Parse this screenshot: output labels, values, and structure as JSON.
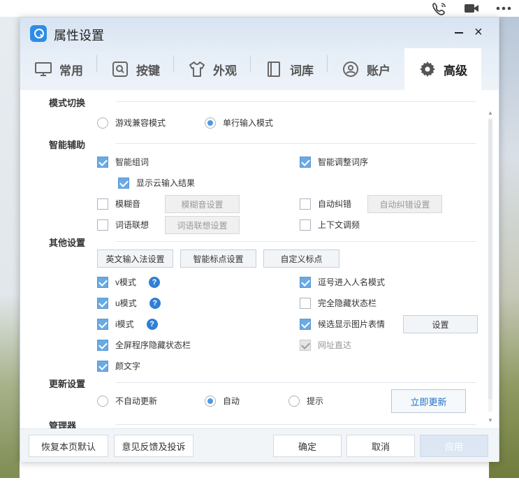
{
  "window": {
    "title": "属性设置"
  },
  "tabs": [
    {
      "label": "常用",
      "icon": "monitor-icon"
    },
    {
      "label": "按键",
      "icon": "keyboard-key-icon"
    },
    {
      "label": "外观",
      "icon": "tshirt-icon"
    },
    {
      "label": "词库",
      "icon": "book-icon"
    },
    {
      "label": "账户",
      "icon": "user-icon"
    },
    {
      "label": "高级",
      "icon": "gear-icon",
      "active": true
    }
  ],
  "sections": {
    "mode": {
      "title": "模式切换",
      "options": [
        {
          "label": "游戏兼容模式",
          "selected": false
        },
        {
          "label": "单行输入模式",
          "selected": true
        }
      ]
    },
    "smart": {
      "title": "智能辅助",
      "smart_group": {
        "label": "智能组词",
        "checked": true
      },
      "cloud_result": {
        "label": "显示云输入结果",
        "checked": true
      },
      "smart_order": {
        "label": "智能调整词序",
        "checked": true
      },
      "fuzzy": {
        "label": "模糊音",
        "checked": false,
        "button": "模糊音设置"
      },
      "autocorrect": {
        "label": "自动纠错",
        "checked": false,
        "button": "自动纠错设置"
      },
      "association": {
        "label": "词语联想",
        "checked": false,
        "button": "词语联想设置"
      },
      "context_freq": {
        "label": "上下文调频",
        "checked": false
      }
    },
    "other": {
      "title": "其他设置",
      "buttons": [
        "英文输入法设置",
        "智能标点设置",
        "自定义标点"
      ],
      "v_mode": {
        "label": "v模式",
        "checked": true
      },
      "u_mode": {
        "label": "u模式",
        "checked": true
      },
      "i_mode": {
        "label": "i模式",
        "checked": true
      },
      "fullscreen_hide": {
        "label": "全屏程序隐藏状态栏",
        "checked": true
      },
      "emoticon": {
        "label": "颜文字",
        "checked": true
      },
      "comma_name": {
        "label": "逗号进入人名模式",
        "checked": true
      },
      "hide_statusbar": {
        "label": "完全隐藏状态栏",
        "checked": false
      },
      "image_emoji": {
        "label": "候选显示图片表情",
        "checked": true,
        "button": "设置"
      },
      "url_direct": {
        "label": "网址直达",
        "checked": true,
        "disabled": true
      },
      "help_glyph": "?"
    },
    "update": {
      "title": "更新设置",
      "options": [
        {
          "label": "不自动更新",
          "selected": false
        },
        {
          "label": "自动",
          "selected": true
        },
        {
          "label": "提示",
          "selected": false
        }
      ],
      "button": "立即更新"
    },
    "manager": {
      "title": "管理器"
    }
  },
  "footer": {
    "restore": "恢复本页默认",
    "feedback": "意见反馈及投诉",
    "ok": "确定",
    "cancel": "取消",
    "apply": "应用"
  },
  "window_controls": {
    "close": "×"
  },
  "colors": {
    "accent": "#4e9ae0",
    "checkbox": "#6aaae4",
    "link": "#1f6fc6"
  }
}
